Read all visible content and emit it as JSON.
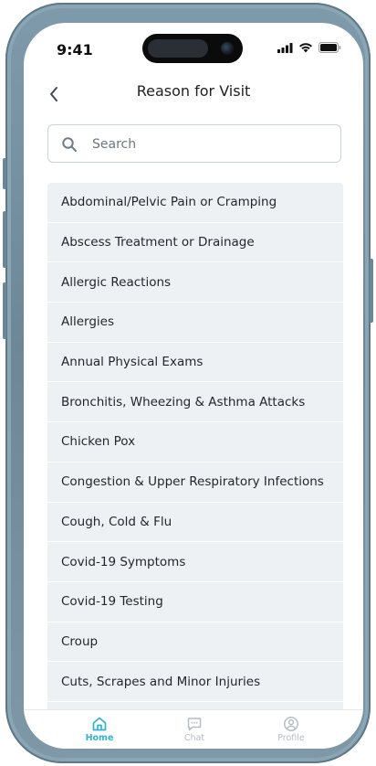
{
  "status_bar": {
    "time": "9:41"
  },
  "header": {
    "title": "Reason for Visit"
  },
  "search": {
    "placeholder": "Search",
    "value": ""
  },
  "reasons": [
    "Abdominal/Pelvic Pain or Cramping",
    "Abscess Treatment or Drainage",
    "Allergic Reactions",
    "Allergies",
    "Annual Physical Exams",
    "Bronchitis, Wheezing & Asthma Attacks",
    "Chicken Pox",
    "Congestion & Upper Respiratory Infections",
    "Cough, Cold & Flu",
    "Covid-19 Symptoms",
    "Covid-19 Testing",
    "Croup",
    "Cuts, Scrapes and Minor Injuries",
    ""
  ],
  "tabs": [
    {
      "label": "Home",
      "icon": "home-icon",
      "active": true
    },
    {
      "label": "Chat",
      "icon": "chat-icon",
      "active": false
    },
    {
      "label": "Profile",
      "icon": "profile-icon",
      "active": false
    }
  ],
  "colors": {
    "accent": "#2fb4cf",
    "list_bg": "#eef1f4",
    "frame": "#7f9bab"
  }
}
